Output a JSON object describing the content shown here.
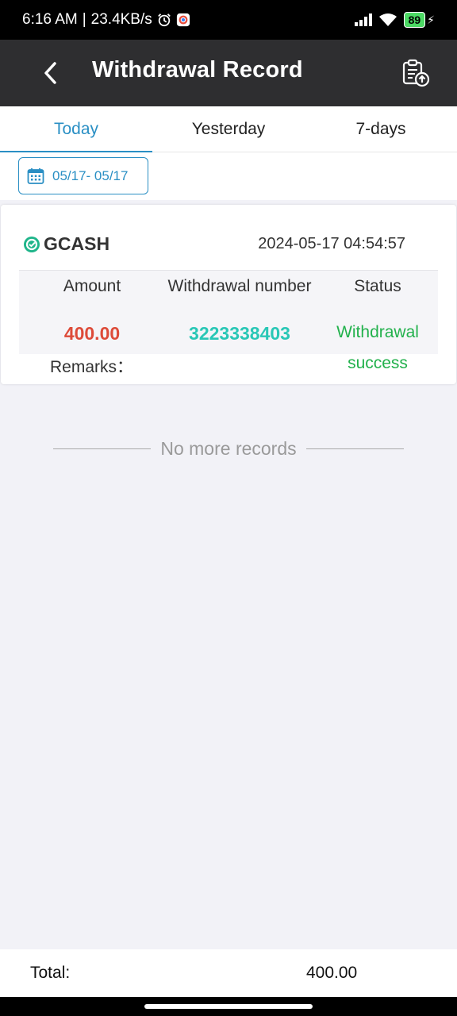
{
  "status_bar": {
    "time": "6:16 AM",
    "separator": "|",
    "network_speed": "23.4KB/s",
    "battery": "89",
    "icons": [
      "alarm-icon",
      "chrome-icon",
      "signal-icon",
      "wifi-icon",
      "battery-icon",
      "charging-icon"
    ]
  },
  "header": {
    "title": "Withdrawal Record",
    "back_icon": "chevron-left-icon",
    "action_icon": "clipboard-upload-icon"
  },
  "tabs": [
    {
      "label": "Today",
      "active": true
    },
    {
      "label": "Yesterday",
      "active": false
    },
    {
      "label": "7-days",
      "active": false
    }
  ],
  "date_filter": {
    "range": "05/17- 05/17",
    "icon": "calendar-icon"
  },
  "record": {
    "method": "GCASH",
    "datetime": "2024-05-17 04:54:57",
    "columns": {
      "amount": "Amount",
      "number": "Withdrawal number",
      "status": "Status"
    },
    "amount": "400.00",
    "withdrawal_number": "3223338403",
    "status_line1": "Withdrawal",
    "status_line2": "success",
    "remarks_label": "Remarks："
  },
  "no_more": "No more records",
  "footer": {
    "total_label": "Total:",
    "total_value": "400.00"
  },
  "colors": {
    "accent": "#2a8fc4",
    "amount": "#dd4b39",
    "number": "#29c7b6",
    "success": "#22b14c",
    "header_bg": "#2e2e30"
  }
}
